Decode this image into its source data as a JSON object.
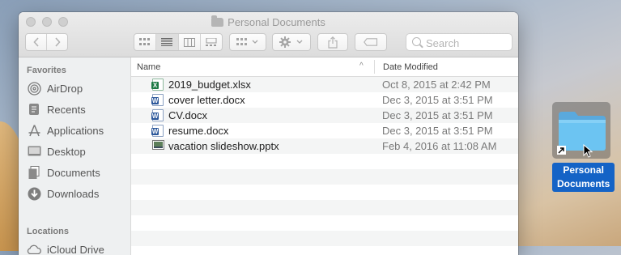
{
  "window": {
    "title": "Personal Documents",
    "toolbar": {
      "back_icon": "chevron-left-icon",
      "forward_icon": "chevron-right-icon",
      "view_modes": [
        "icon-view-icon",
        "list-view-icon",
        "column-view-icon",
        "gallery-view-icon"
      ],
      "active_view": 1,
      "group_icon": "group-icon",
      "action_icon": "gear-icon",
      "share_icon": "share-icon",
      "tag_icon": "tag-icon",
      "search_placeholder": "Search"
    }
  },
  "sidebar": {
    "favorites_heading": "Favorites",
    "favorites": [
      {
        "label": "AirDrop",
        "icon": "airdrop-icon"
      },
      {
        "label": "Recents",
        "icon": "recents-icon"
      },
      {
        "label": "Applications",
        "icon": "applications-icon"
      },
      {
        "label": "Desktop",
        "icon": "desktop-icon"
      },
      {
        "label": "Documents",
        "icon": "documents-icon"
      },
      {
        "label": "Downloads",
        "icon": "downloads-icon"
      }
    ],
    "locations_heading": "Locations",
    "locations": [
      {
        "label": "iCloud Drive",
        "icon": "cloud-icon"
      }
    ]
  },
  "file_list": {
    "columns": {
      "name": "Name",
      "date_modified": "Date Modified"
    },
    "rows": [
      {
        "name": "2019_budget.xlsx",
        "date": "Oct 8, 2015 at 2:42 PM",
        "type": "excel"
      },
      {
        "name": "cover letter.docx",
        "date": "Dec 3, 2015 at 3:51 PM",
        "type": "word"
      },
      {
        "name": "CV.docx",
        "date": "Dec 3, 2015 at 3:51 PM",
        "type": "word"
      },
      {
        "name": "resume.docx",
        "date": "Dec 3, 2015 at 3:51 PM",
        "type": "word"
      },
      {
        "name": "vacation slideshow.pptx",
        "date": "Feb 4, 2016 at 11:08 AM",
        "type": "slides"
      }
    ]
  },
  "desktop_icon": {
    "label_line1": "Personal",
    "label_line2": "Documents",
    "icon": "alias-folder-icon"
  },
  "colors": {
    "selection_blue": "#1463c6",
    "folder_blue": "#6cc4f2",
    "excel_green": "#1e7a45",
    "word_blue": "#2b579a"
  }
}
